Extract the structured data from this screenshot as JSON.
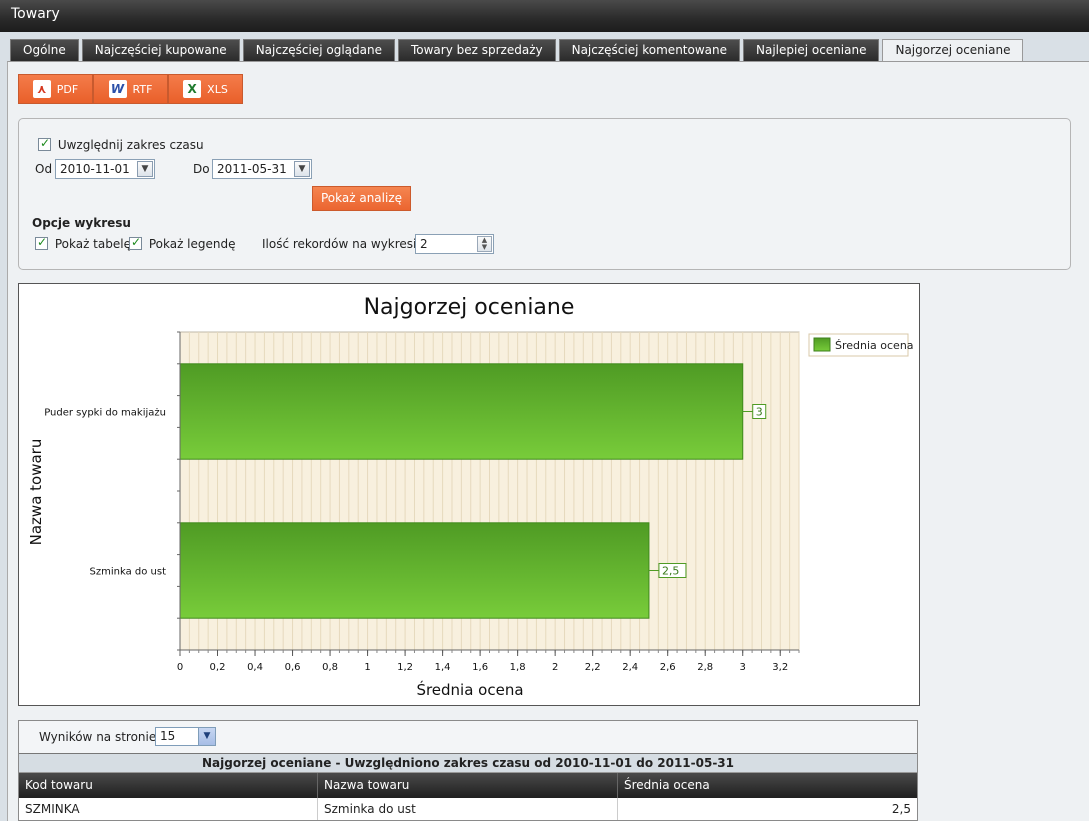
{
  "window": {
    "title": "Towary"
  },
  "tabs": [
    {
      "label": "Ogólne",
      "active": false
    },
    {
      "label": "Najczęściej kupowane",
      "active": false
    },
    {
      "label": "Najczęściej oglądane",
      "active": false
    },
    {
      "label": "Towary bez sprzedaży",
      "active": false
    },
    {
      "label": "Najczęściej komentowane",
      "active": false
    },
    {
      "label": "Najlepiej oceniane",
      "active": false
    },
    {
      "label": "Najgorzej oceniane",
      "active": true
    }
  ],
  "export": {
    "pdf": "PDF",
    "rtf": "RTF",
    "xls": "XLS"
  },
  "filters": {
    "use_range_label": "Uwzględnij zakres czasu",
    "from_label": "Od",
    "from_value": "2010-11-01",
    "to_label": "Do",
    "to_value": "2011-05-31",
    "analyze_button": "Pokaż analizę",
    "chart_options_heading": "Opcje wykresu",
    "show_table_label": "Pokaż tabelę",
    "show_legend_label": "Pokaż legendę",
    "records_label": "Ilość rekordów na wykresie",
    "records_value": "2"
  },
  "chart_data": {
    "type": "bar",
    "orientation": "horizontal",
    "title": "Najgorzej oceniane",
    "xlabel": "Średnia ocena",
    "ylabel": "Nazwa towaru",
    "categories": [
      "Puder sypki do makijażu",
      "Szminka do ust"
    ],
    "series": [
      {
        "name": "Średnia ocena",
        "values": [
          3,
          2.5
        ]
      }
    ],
    "data_labels": [
      "3",
      "2,5"
    ],
    "xlim": [
      0,
      3.3
    ],
    "xticks": [
      "0",
      "0,2",
      "0,4",
      "0,6",
      "0,8",
      "1",
      "1,2",
      "1,4",
      "1,6",
      "1,8",
      "2",
      "2,2",
      "2,4",
      "2,6",
      "2,8",
      "3",
      "3,2"
    ],
    "grid": true,
    "legend": "top-right",
    "bar_color": "#5cb82e"
  },
  "table": {
    "page_size_label": "Wyników na stronie:",
    "page_size_value": "15",
    "caption": "Najgorzej oceniane - Uwzględniono zakres czasu od 2010-11-01 do 2011-05-31",
    "columns": [
      "Kod towaru",
      "Nazwa towaru",
      "Średnia ocena"
    ],
    "rows": [
      [
        "SZMINKA",
        "Szminka do ust",
        "2,5"
      ]
    ]
  }
}
